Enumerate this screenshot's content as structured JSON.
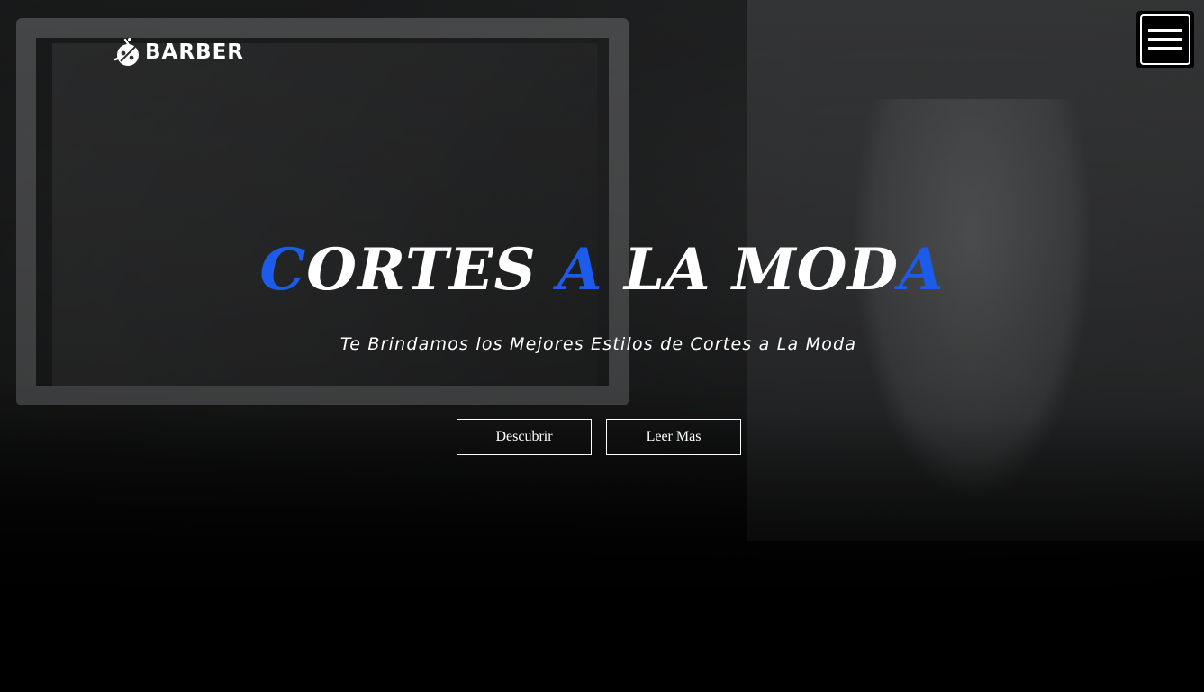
{
  "brand": {
    "name": "BARBER",
    "logo_icon": "barber-logo-icon"
  },
  "nav": {
    "menu_icon": "hamburger-menu-icon"
  },
  "hero": {
    "headline_parts": [
      {
        "text": "C",
        "accent": true
      },
      {
        "text": "ORTES ",
        "accent": false
      },
      {
        "text": "A",
        "accent": true
      },
      {
        "text": " LA MOD",
        "accent": false
      },
      {
        "text": "A",
        "accent": true
      }
    ],
    "subtitle": "Te Brindamos los Mejores Estilos de Cortes a La Moda",
    "buttons": {
      "discover": "Descubrir",
      "read_more": "Leer Mas"
    }
  },
  "colors": {
    "accent": "#1d5bea",
    "text": "#ffffff",
    "background": "#000000"
  }
}
